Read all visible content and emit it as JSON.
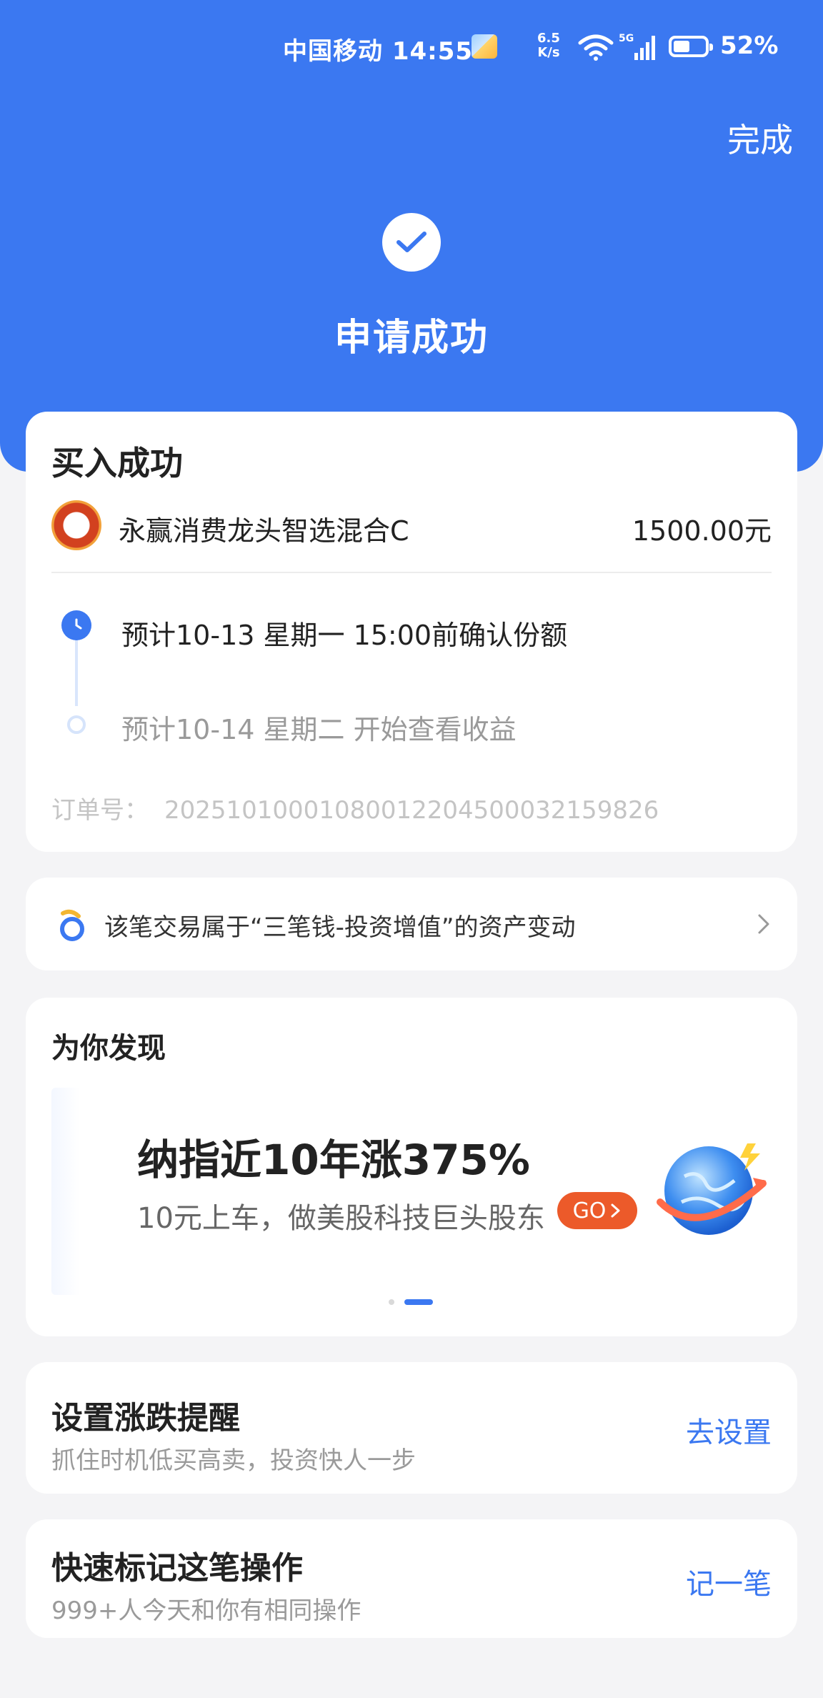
{
  "status_bar": {
    "carrier_time": "中国移动 14:55",
    "net_speed_value": "6.5",
    "net_speed_unit": "K/s",
    "network": "5G",
    "battery_level": 0.52,
    "battery_percent": "52%"
  },
  "header": {
    "done_label": "完成",
    "title": "申请成功"
  },
  "order": {
    "title": "买入成功",
    "fund_name": "永赢消费龙头智选混合C",
    "amount": "1500.00元",
    "timeline": [
      "预计10-13 星期一 15:00前确认份额",
      "预计10-14 星期二 开始查看收益"
    ],
    "order_no_label": "订单号：",
    "order_no": "20251010001080012204500032159826"
  },
  "asset_notice": {
    "text": "该笔交易属于“三笔钱-投资增值”的资产变动"
  },
  "discover": {
    "title": "为你发现",
    "banner_headline": "纳指近10年涨375%",
    "banner_sub": "10元上车，做美股科技巨头股东",
    "go_label": "GO"
  },
  "remind": {
    "title": "设置涨跌提醒",
    "subtitle": "抓住时机低买高卖，投资快人一步",
    "action": "去设置"
  },
  "mark": {
    "title": "快速标记这笔操作",
    "subtitle": "999+人今天和你有相同操作",
    "action": "记一笔"
  },
  "colors": {
    "brand_blue": "#3b78f1",
    "go_orange": "#ec5a2a",
    "fund_logo": "#d2411f"
  }
}
